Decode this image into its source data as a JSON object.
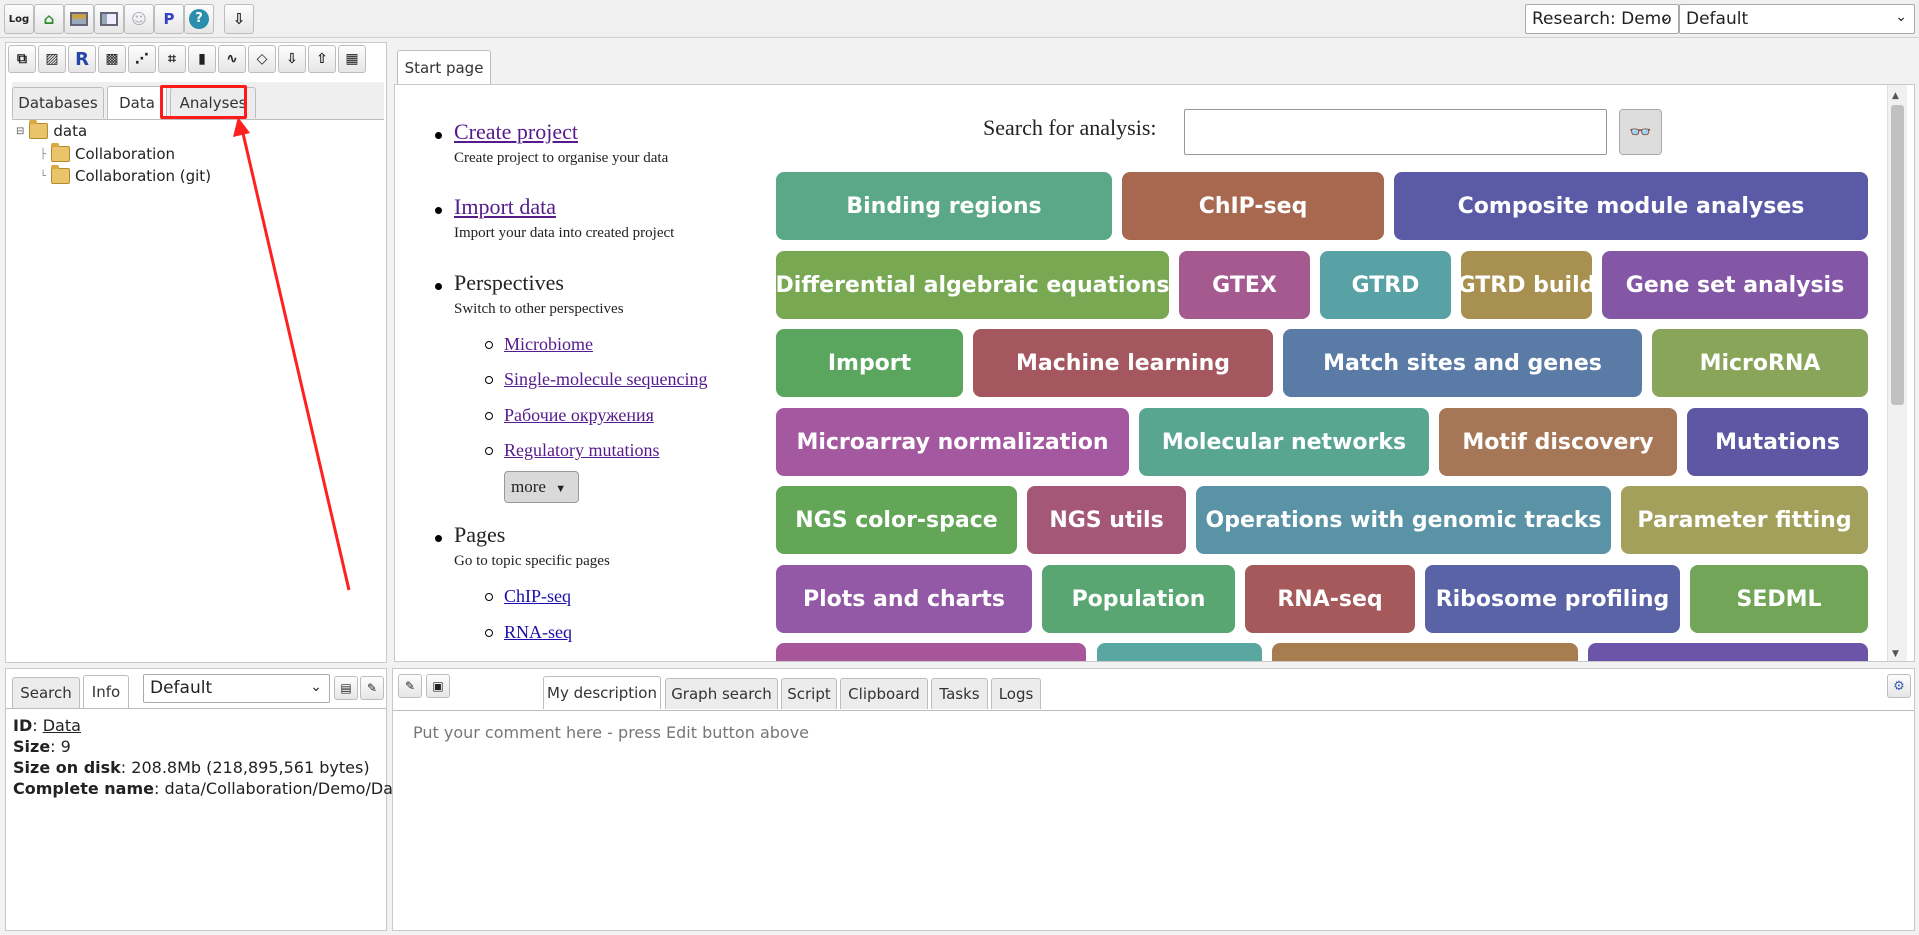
{
  "toolbar": {
    "research_select": "Research: Demo",
    "perspective_select": "Default",
    "icons": [
      "log-icon",
      "home-icon",
      "layout-icon",
      "panel-icon",
      "user-icon",
      "p-icon",
      "help-icon",
      "export-icon"
    ]
  },
  "left_toolbar_icons": [
    "copy-icon",
    "image-icon",
    "r-icon",
    "image2-icon",
    "graph-icon",
    "diagram-icon",
    "folder-icon",
    "chart-icon",
    "diamond-icon",
    "download-icon",
    "upload-icon",
    "clipboard-icon"
  ],
  "tree_tabs": [
    "Databases",
    "Data",
    "Analyses"
  ],
  "tree": {
    "root": "data",
    "children": [
      "Collaboration",
      "Collaboration (git)"
    ]
  },
  "start_tab": "Start page",
  "start": {
    "create_project": "Create project",
    "create_project_desc": "Create project to organise your data",
    "import_data": "Import data",
    "import_data_desc": "Import your data into created project",
    "perspectives": "Perspectives",
    "perspectives_desc": "Switch to other perspectives",
    "perspective_links": [
      "Microbiome",
      "Single-molecule sequencing",
      "Рабочие окружения",
      "Regulatory mutations"
    ],
    "more_label": "more",
    "pages": "Pages",
    "pages_desc": "Go to topic specific pages",
    "page_links": [
      "ChIP-seq",
      "RNA-seq"
    ],
    "search_label": "Search for analysis:",
    "search_value": ""
  },
  "analysis_tiles": [
    {
      "label": "Binding regions",
      "color": "#5ba889"
    },
    {
      "label": "ChIP-seq",
      "color": "#a7684f"
    },
    {
      "label": "Composite module analyses",
      "color": "#5a5aa7"
    },
    {
      "label": "Differential algebraic equations",
      "color": "#79a853"
    },
    {
      "label": "GTEX",
      "color": "#a45a8e"
    },
    {
      "label": "GTRD",
      "color": "#58a1a4"
    },
    {
      "label": "GTRD build",
      "color": "#a79050"
    },
    {
      "label": "Gene set analysis",
      "color": "#8357a6"
    },
    {
      "label": "Import",
      "color": "#5aa65e"
    },
    {
      "label": "Machine learning",
      "color": "#a5575f"
    },
    {
      "label": "Match sites and genes",
      "color": "#5a7ba6"
    },
    {
      "label": "MicroRNA",
      "color": "#88a55a"
    },
    {
      "label": "Microarray normalization",
      "color": "#a4589f"
    },
    {
      "label": "Molecular networks",
      "color": "#58a690"
    },
    {
      "label": "Motif discovery",
      "color": "#a67757"
    },
    {
      "label": "Mutations",
      "color": "#5f56a4"
    },
    {
      "label": "NGS color-space",
      "color": "#63a658"
    },
    {
      "label": "NGS utils",
      "color": "#a55778"
    },
    {
      "label": "Operations with genomic tracks",
      "color": "#5a93a5"
    },
    {
      "label": "Parameter fitting",
      "color": "#a2a05b"
    },
    {
      "label": "Plots and charts",
      "color": "#9358a6"
    },
    {
      "label": "Population",
      "color": "#5aa672"
    },
    {
      "label": "RNA-seq",
      "color": "#a5595a"
    },
    {
      "label": "Ribosome profiling",
      "color": "#5963a5"
    },
    {
      "label": "SEDML",
      "color": "#72a558"
    }
  ],
  "bottom_left": {
    "tabs": [
      "Search",
      "Info"
    ],
    "select": "Default",
    "info": [
      {
        "key": "ID",
        "value": "Data"
      },
      {
        "key": "Size",
        "value": "9"
      },
      {
        "key": "Size on disk",
        "value": "208.8Mb (218,895,561 bytes)"
      },
      {
        "key": "Complete name",
        "value": "data/Collaboration/Demo/Data"
      }
    ]
  },
  "bottom_right": {
    "tabs": [
      "My description",
      "Graph search",
      "Script",
      "Clipboard",
      "Tasks",
      "Logs"
    ],
    "placeholder": "Put your comment here - press Edit button above"
  }
}
